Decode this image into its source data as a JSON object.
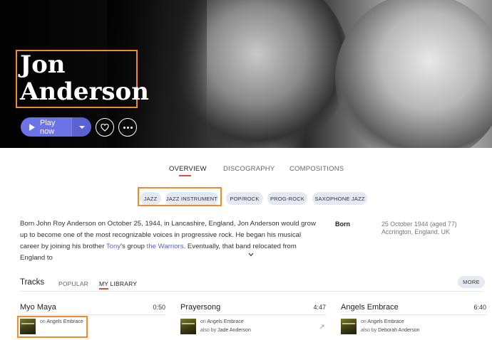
{
  "artist": {
    "name_line1": "Jon",
    "name_line2": "Anderson"
  },
  "actions": {
    "play_label": "Play now",
    "favorite_icon": "heart-icon",
    "more_icon": "more-dots-icon"
  },
  "tabs": [
    {
      "label": "OVERVIEW",
      "active": true
    },
    {
      "label": "DISCOGRAPHY",
      "active": false
    },
    {
      "label": "COMPOSITIONS",
      "active": false
    }
  ],
  "genres": [
    "JAZZ",
    "JAZZ INSTRUMENT",
    "POP/ROCK",
    "PROG-ROCK",
    "SAXOPHONE JAZZ"
  ],
  "bio": {
    "part1": "Born John Roy Anderson on October 25, 1944, in Lancashire, England, Jon Anderson would grow up to become one of the most recognizable voices in progressive rock. He began his musical career by joining his brother ",
    "link1": "Tony",
    "part2": "'s group ",
    "link2": "the Warriors",
    "part3": ". Eventually, that band relocated from England to"
  },
  "born": {
    "label": "Born",
    "date": "25 October 1944 (aged 77)",
    "place": "Accrington, England, UK"
  },
  "tracks_section": {
    "title": "Tracks",
    "tabs": [
      {
        "label": "POPULAR",
        "active": false
      },
      {
        "label": "MY LIBRARY",
        "active": true
      }
    ],
    "more_label": "MORE",
    "items": [
      {
        "name": "Myo Maya",
        "duration": "0:50",
        "on_prefix": "on",
        "album": "Angels Embrace",
        "also_prefix": "",
        "also_artist": ""
      },
      {
        "name": "Prayersong",
        "duration": "4:47",
        "on_prefix": "on",
        "album": "Angels Embrace",
        "also_prefix": "also by",
        "also_artist": "Jade Anderson"
      },
      {
        "name": "Angels Embrace",
        "duration": "6:40",
        "on_prefix": "on",
        "album": "Angels Embrace",
        "also_prefix": "also by",
        "also_artist": "Deborah Anderson"
      }
    ]
  },
  "colors": {
    "accent": "#6b73e6",
    "highlight": "#f08a2c",
    "tab_underline": "#e04b3a",
    "chip_bg": "#e6e9f2"
  }
}
